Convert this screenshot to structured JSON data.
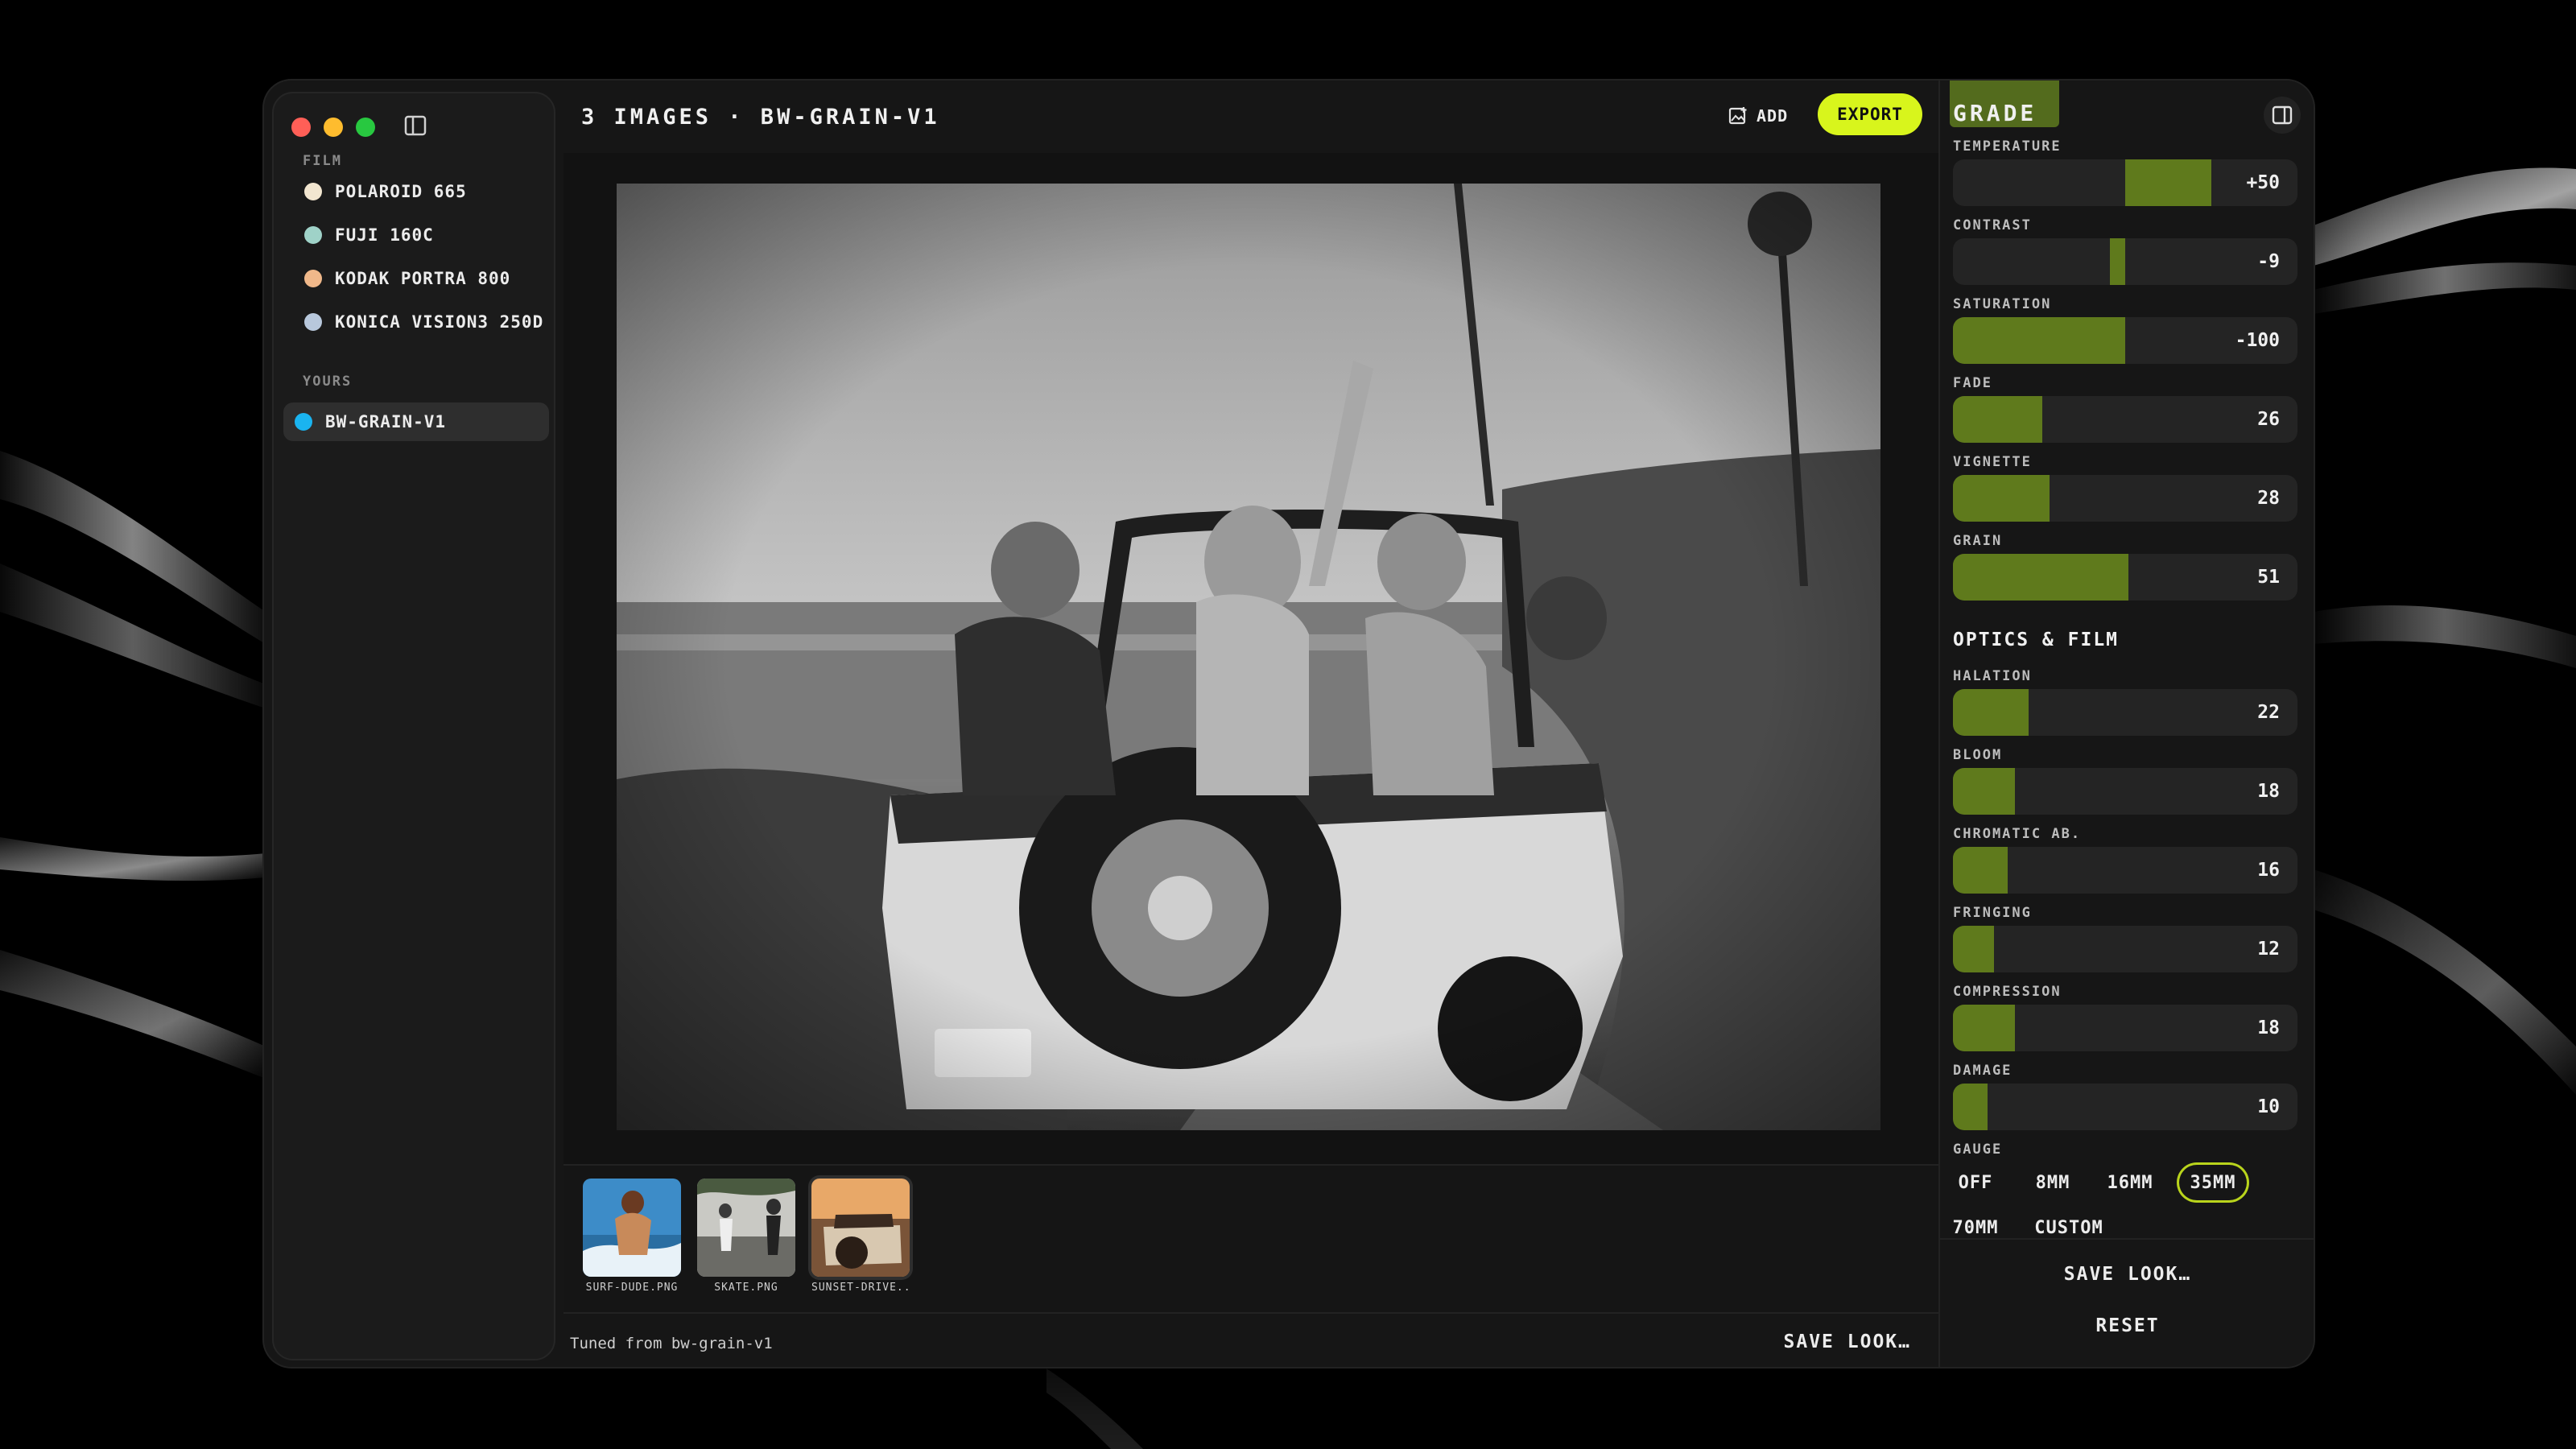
{
  "window": {
    "title": "3 IMAGES · BW-GRAIN-V1",
    "add_label": "ADD",
    "export_label": "EXPORT"
  },
  "sidebar": {
    "film_label": "FILM",
    "films": [
      {
        "label": "POLAROID 665",
        "color": "#f2e6d0"
      },
      {
        "label": "FUJI 160C",
        "color": "#9fd2c8"
      },
      {
        "label": "KODAK PORTRA 800",
        "color": "#f0b88a"
      },
      {
        "label": "KONICA VISION3 250D",
        "color": "#b8c8dc"
      }
    ],
    "yours_label": "YOURS",
    "yours": [
      {
        "label": "BW-GRAIN-V1",
        "color": "#1ab4f0",
        "active": true
      }
    ]
  },
  "filmstrip": [
    {
      "caption": "SURF-DUDE.PNG"
    },
    {
      "caption": "SKATE.PNG"
    },
    {
      "caption": "SUNSET-DRIVE..."
    }
  ],
  "status": {
    "note": "Tuned from bw-grain-v1",
    "save_label": "SAVE LOOK…"
  },
  "grade": {
    "title": "GRADE",
    "controls": [
      {
        "label": "TEMPERATURE",
        "value": "+50",
        "level": 50,
        "bipolar": true
      },
      {
        "label": "CONTRAST",
        "value": "-9",
        "level": -9,
        "bipolar": true
      },
      {
        "label": "SATURATION",
        "value": "-100",
        "level": -100,
        "bipolar": true
      },
      {
        "label": "FADE",
        "value": "26",
        "level": 26,
        "bipolar": false
      },
      {
        "label": "VIGNETTE",
        "value": "28",
        "level": 28,
        "bipolar": false
      },
      {
        "label": "GRAIN",
        "value": "51",
        "level": 51,
        "bipolar": false
      }
    ],
    "optics_title": "OPTICS & FILM",
    "optics": [
      {
        "label": "HALATION",
        "value": "22",
        "level": 22
      },
      {
        "label": "BLOOM",
        "value": "18",
        "level": 18
      },
      {
        "label": "CHROMATIC AB.",
        "value": "16",
        "level": 16
      },
      {
        "label": "FRINGING",
        "value": "12",
        "level": 12
      },
      {
        "label": "COMPRESSION",
        "value": "18",
        "level": 18
      },
      {
        "label": "DAMAGE",
        "value": "10",
        "level": 10
      }
    ],
    "gauge_label": "GAUGE",
    "gauge_options": [
      "OFF",
      "8MM",
      "16MM",
      "35MM",
      "70MM",
      "CUSTOM"
    ],
    "gauge_selected": "35MM",
    "save_label": "SAVE LOOK…",
    "reset_label": "RESET"
  },
  "colors": {
    "accent": "#d8f51c",
    "slider_fill": "#5f7a1c",
    "traffic_red": "#ff5f57",
    "traffic_yellow": "#febc2e",
    "traffic_green": "#28c840"
  }
}
